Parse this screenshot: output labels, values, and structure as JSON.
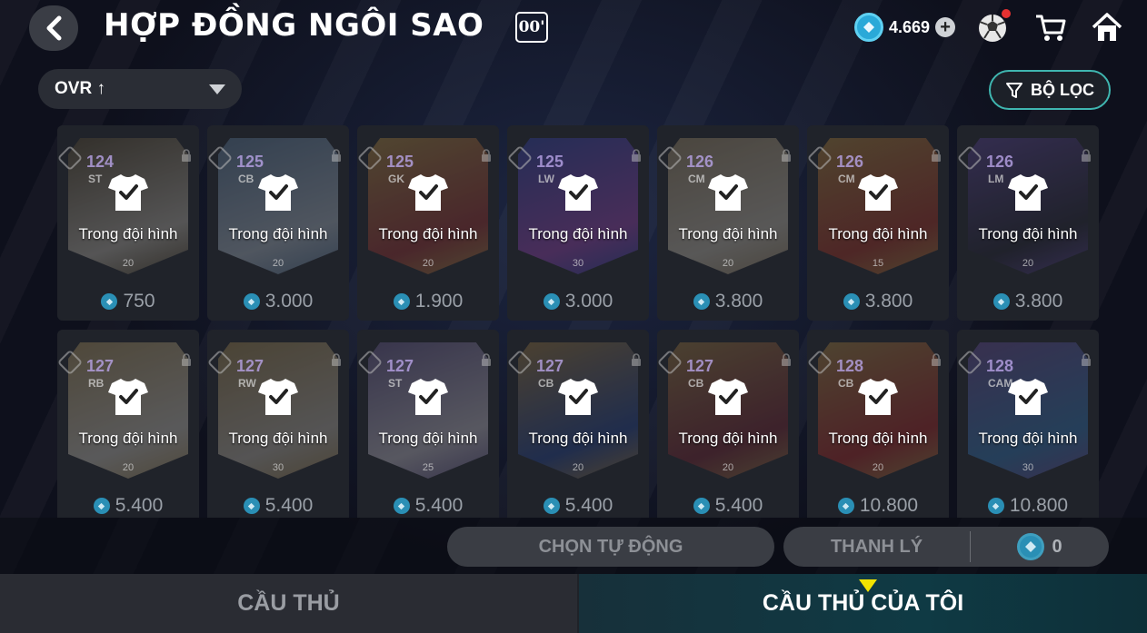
{
  "header": {
    "title": "HỢP ĐỒNG NGÔI SAO",
    "badge": "00'",
    "currency_value": "4.669"
  },
  "sort": {
    "label": "OVR ↑"
  },
  "filter": {
    "label": "BỘ LỌC"
  },
  "cards": [
    {
      "ovr": "124",
      "pos": "ST",
      "level": "20",
      "status": "Trong đội hình",
      "price": "750",
      "art": [
        "#6a5a3a",
        "#d9d2c4"
      ]
    },
    {
      "ovr": "125",
      "pos": "CB",
      "level": "20",
      "status": "Trong đội hình",
      "price": "3.000",
      "art": [
        "#6b8fb3",
        "#c7d6e6"
      ]
    },
    {
      "ovr": "125",
      "pos": "GK",
      "level": "20",
      "status": "Trong đội hình",
      "price": "1.900",
      "art": [
        "#c9a14a",
        "#b43a3a"
      ]
    },
    {
      "ovr": "125",
      "pos": "LW",
      "level": "30",
      "status": "Trong đội hình",
      "price": "3.000",
      "art": [
        "#3b4fc8",
        "#b04fd0"
      ]
    },
    {
      "ovr": "126",
      "pos": "CM",
      "level": "20",
      "status": "Trong đội hình",
      "price": "3.800",
      "art": [
        "#b8a27a",
        "#e4dccb"
      ]
    },
    {
      "ovr": "126",
      "pos": "CM",
      "level": "15",
      "status": "Trong đội hình",
      "price": "3.800",
      "art": [
        "#c79a44",
        "#c43a2a"
      ]
    },
    {
      "ovr": "126",
      "pos": "LM",
      "level": "20",
      "status": "Trong đội hình",
      "price": "3.800",
      "art": [
        "#6a4fb0",
        "#2a2a3a"
      ]
    },
    {
      "ovr": "127",
      "pos": "RB",
      "level": "20",
      "status": "Trong đội hình",
      "price": "5.400",
      "art": [
        "#c4a86a",
        "#e8e2d6"
      ]
    },
    {
      "ovr": "127",
      "pos": "RW",
      "level": "30",
      "status": "Trong đội hình",
      "price": "5.400",
      "art": [
        "#b89a5a",
        "#d8d0c2"
      ]
    },
    {
      "ovr": "127",
      "pos": "ST",
      "level": "25",
      "status": "Trong đội hình",
      "price": "5.400",
      "art": [
        "#7a6aa6",
        "#e0dbe8"
      ]
    },
    {
      "ovr": "127",
      "pos": "CB",
      "level": "20",
      "status": "Trong đội hình",
      "price": "5.400",
      "art": [
        "#b8904a",
        "#2a4fa8"
      ]
    },
    {
      "ovr": "127",
      "pos": "CB",
      "level": "20",
      "status": "Trong đội hình",
      "price": "5.400",
      "art": [
        "#b8904a",
        "#8a2a3a"
      ]
    },
    {
      "ovr": "128",
      "pos": "CB",
      "level": "20",
      "status": "Trong đội hình",
      "price": "10.800",
      "art": [
        "#c49a4a",
        "#c42a2a"
      ]
    },
    {
      "ovr": "128",
      "pos": "CAM",
      "level": "30",
      "status": "Trong đội hình",
      "price": "10.800",
      "art": [
        "#7a5ab0",
        "#3a8ad0"
      ]
    }
  ],
  "actions": {
    "auto_select": "CHỌN TỰ ĐỘNG",
    "sell": "THANH LÝ",
    "sell_amount": "0"
  },
  "tabs": [
    {
      "label": "CẦU THỦ"
    },
    {
      "label": "CẦU THỦ CỦA TÔI",
      "active": true
    }
  ]
}
